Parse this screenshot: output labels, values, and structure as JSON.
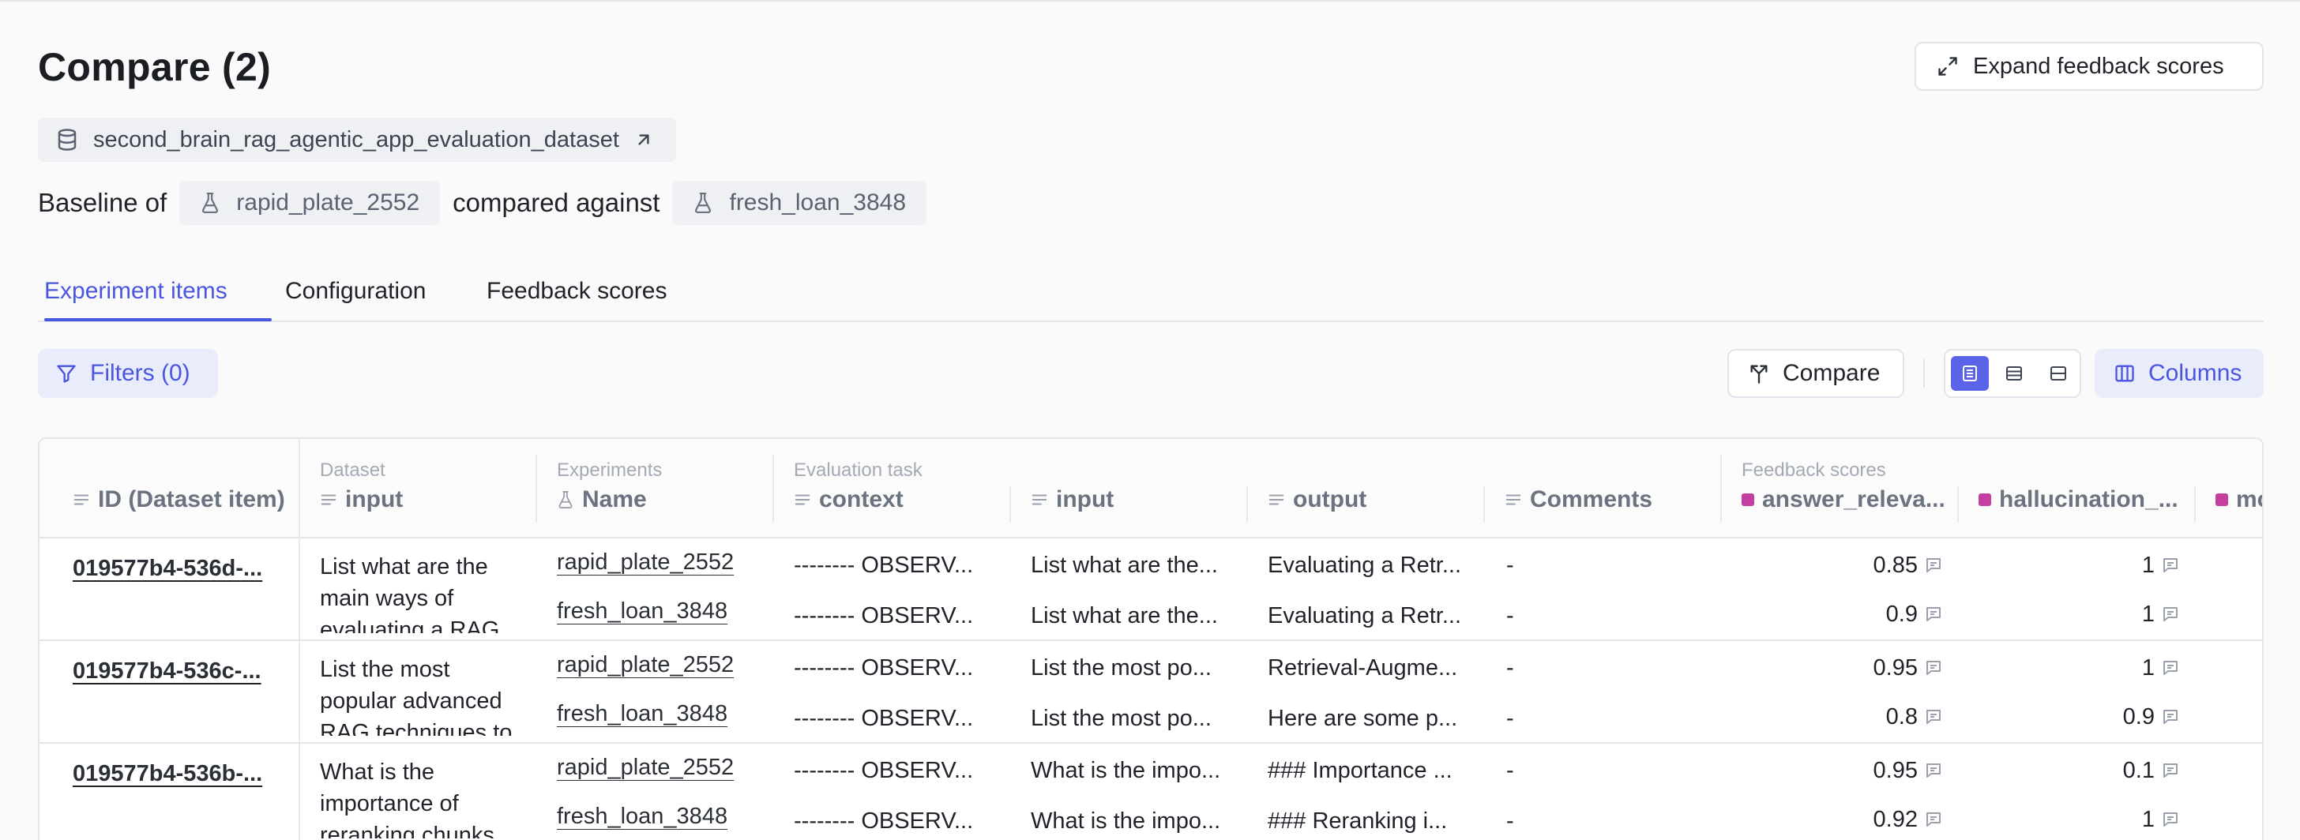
{
  "header": {
    "title": "Compare (2)",
    "expand_label": "Expand feedback scores"
  },
  "dataset": {
    "name": "second_brain_rag_agentic_app_evaluation_dataset"
  },
  "baseline": {
    "prefix": "Baseline of",
    "baseline_experiment": "rapid_plate_2552",
    "middle": "compared against",
    "compared_experiment": "fresh_loan_3848"
  },
  "tabs": [
    {
      "label": "Experiment items"
    },
    {
      "label": "Configuration"
    },
    {
      "label": "Feedback scores"
    }
  ],
  "toolbar": {
    "filters_label": "Filters (0)",
    "compare_label": "Compare",
    "columns_label": "Columns"
  },
  "table": {
    "groups": {
      "dataset": "Dataset",
      "experiments": "Experiments",
      "evaluation_task": "Evaluation task",
      "feedback_scores": "Feedback scores"
    },
    "columns": {
      "id": "ID (Dataset item)",
      "input": "input",
      "name": "Name",
      "context": "context",
      "task_input": "input",
      "output": "output",
      "comments": "Comments",
      "score1": "answer_releva...",
      "score2": "hallucination_...",
      "score3": "mo"
    },
    "rows": [
      {
        "id": "019577b4-536d-...",
        "input": "List what are the main ways of evaluating a RAG",
        "experiments": [
          {
            "name": "rapid_plate_2552",
            "context": "-------- OBSERV...",
            "input": "List what are the...",
            "output": "Evaluating a Retr...",
            "comments": "-",
            "score1": "0.85",
            "score2": "1"
          },
          {
            "name": "fresh_loan_3848",
            "context": "-------- OBSERV...",
            "input": "List what are the...",
            "output": "Evaluating a Retr...",
            "comments": "-",
            "score1": "0.9",
            "score2": "1"
          }
        ]
      },
      {
        "id": "019577b4-536c-...",
        "input": "List the most popular advanced RAG techniques to",
        "experiments": [
          {
            "name": "rapid_plate_2552",
            "context": "-------- OBSERV...",
            "input": "List the most po...",
            "output": "Retrieval-Augme...",
            "comments": "-",
            "score1": "0.95",
            "score2": "1"
          },
          {
            "name": "fresh_loan_3848",
            "context": "-------- OBSERV...",
            "input": "List the most po...",
            "output": "Here are some p...",
            "comments": "-",
            "score1": "0.8",
            "score2": "0.9"
          }
        ]
      },
      {
        "id": "019577b4-536b-...",
        "input": "What is the importance of reranking chunks",
        "experiments": [
          {
            "name": "rapid_plate_2552",
            "context": "-------- OBSERV...",
            "input": "What is the impo...",
            "output": "### Importance ...",
            "comments": "-",
            "score1": "0.95",
            "score2": "0.1"
          },
          {
            "name": "fresh_loan_3848",
            "context": "-------- OBSERV...",
            "input": "What is the impo...",
            "output": "### Reranking i...",
            "comments": "-",
            "score1": "0.92",
            "score2": "1"
          }
        ]
      }
    ]
  },
  "colors": {
    "accent": "#4a56e0",
    "score_marker": "#c43fa0"
  }
}
